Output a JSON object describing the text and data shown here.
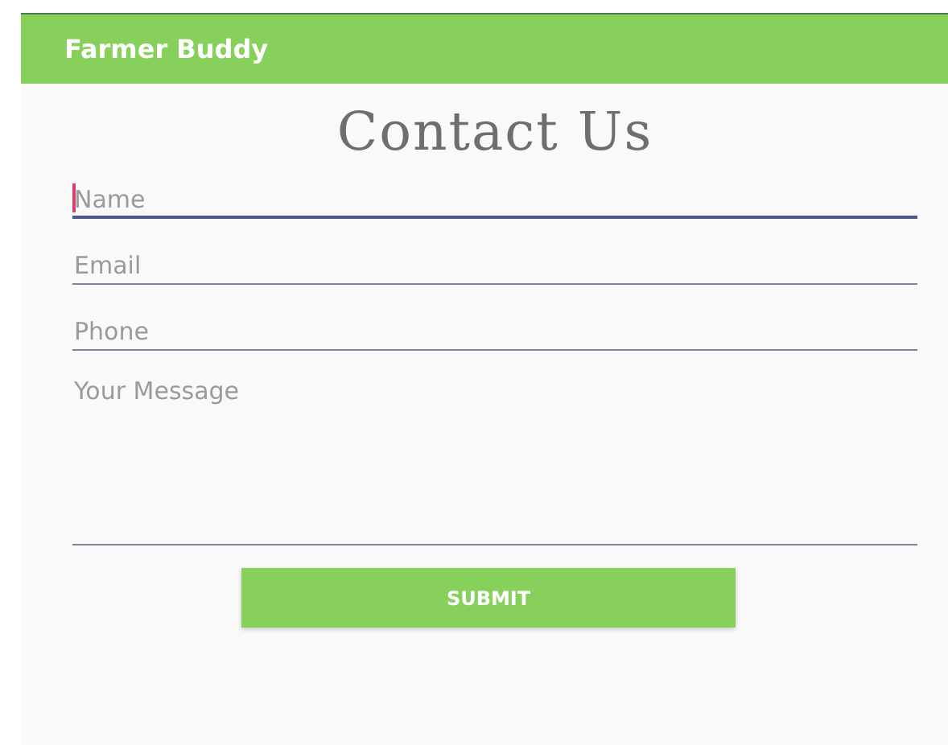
{
  "app_bar": {
    "title": "Farmer Buddy"
  },
  "heading": "Contact Us",
  "fields": [
    {
      "kind": "line",
      "placeholder": "Name",
      "focused": true
    },
    {
      "kind": "line",
      "placeholder": "Email",
      "focused": false
    },
    {
      "kind": "line",
      "placeholder": "Phone",
      "focused": false
    },
    {
      "kind": "multiline",
      "placeholder": "Your Message",
      "focused": false
    }
  ],
  "submit_button": "SUBMIT"
}
